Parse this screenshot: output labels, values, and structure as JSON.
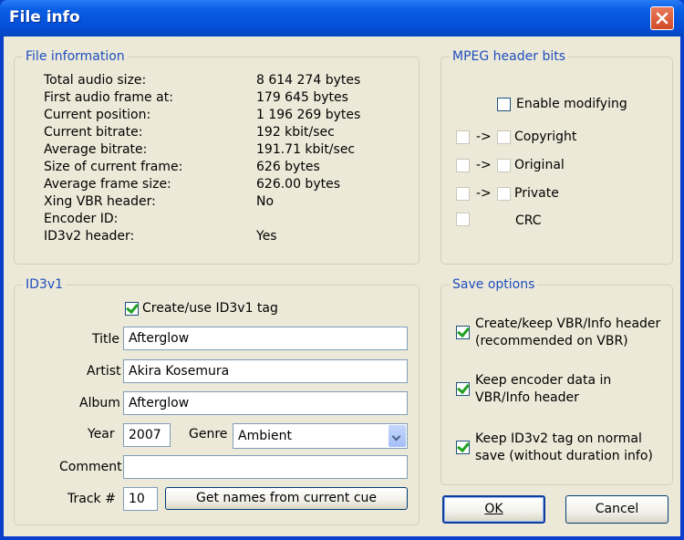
{
  "window": {
    "title": "File info"
  },
  "file_info": {
    "legend": "File information",
    "rows": [
      {
        "label": "Total audio size:",
        "value": "8 614 274 bytes"
      },
      {
        "label": "First audio frame at:",
        "value": "179 645 bytes"
      },
      {
        "label": "Current position:",
        "value": "1 196 269 bytes"
      },
      {
        "label": "Current bitrate:",
        "value": "192 kbit/sec"
      },
      {
        "label": "Average bitrate:",
        "value": "191.71 kbit/sec"
      },
      {
        "label": "Size of current frame:",
        "value": "626 bytes"
      },
      {
        "label": "Average frame size:",
        "value": "626.00 bytes"
      },
      {
        "label": "Xing VBR header:",
        "value": "No"
      },
      {
        "label": "Encoder ID:",
        "value": ""
      },
      {
        "label": "ID3v2 header:",
        "value": "Yes"
      }
    ]
  },
  "mpeg": {
    "legend": "MPEG header bits",
    "enable_modifying": "Enable modifying",
    "arrow": "->",
    "copyright": "Copyright",
    "original": "Original",
    "private": "Private",
    "crc": "CRC"
  },
  "id3v1": {
    "legend": "ID3v1",
    "create_tag": "Create/use ID3v1 tag",
    "create_tag_checked": true,
    "title_label": "Title",
    "title_value": "Afterglow",
    "artist_label": "Artist",
    "artist_value": "Akira Kosemura",
    "album_label": "Album",
    "album_value": "Afterglow",
    "year_label": "Year",
    "year_value": "2007",
    "genre_label": "Genre",
    "genre_value": "Ambient",
    "comment_label": "Comment",
    "comment_value": "",
    "track_label": "Track #",
    "track_value": "10",
    "get_names_button": "Get names from current cue"
  },
  "save_options": {
    "legend": "Save options",
    "opt1_line1": "Create/keep VBR/Info header",
    "opt1_line2": "(recommended on VBR)",
    "opt2_line1": "Keep encoder data in",
    "opt2_line2": "VBR/Info header",
    "opt3_line1": "Keep ID3v2 tag on normal",
    "opt3_line2": "save (without duration info)",
    "opt1_checked": true,
    "opt2_checked": true,
    "opt3_checked": true
  },
  "buttons": {
    "ok": "OK",
    "cancel": "Cancel"
  }
}
